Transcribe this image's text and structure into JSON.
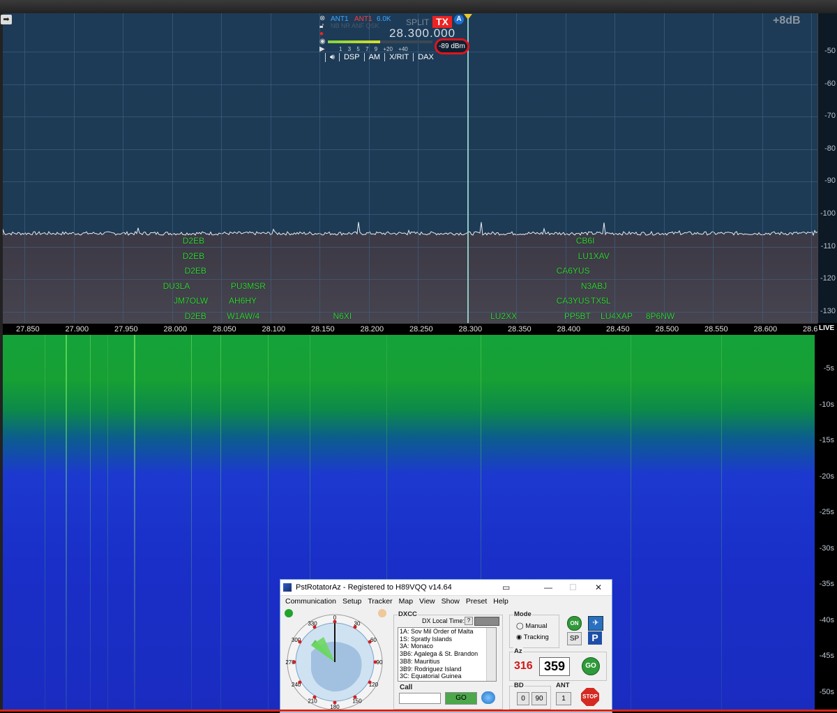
{
  "panadapter": {
    "db_scale": [
      "-50",
      "-60",
      "-70",
      "-80",
      "-90",
      "-100",
      "-110",
      "-120",
      "-130"
    ],
    "gain_label": "+8dB",
    "freq_axis": [
      "27.850",
      "27.900",
      "27.950",
      "28.000",
      "28.050",
      "28.100",
      "28.150",
      "28.200",
      "28.250",
      "28.300",
      "28.350",
      "28.400",
      "28.450",
      "28.500",
      "28.550",
      "28.600",
      "28.6"
    ],
    "live_label": "LIVE",
    "spots": [
      {
        "call": "D2EB",
        "f": 28.025,
        "row": 0
      },
      {
        "call": "D2EB",
        "f": 28.025,
        "row": 1
      },
      {
        "call": "D2EB",
        "f": 28.027,
        "row": 2
      },
      {
        "call": "DU3LA",
        "f": 28.005,
        "row": 3
      },
      {
        "call": "PU3MSR",
        "f": 28.074,
        "row": 3
      },
      {
        "call": "JM7OLW",
        "f": 28.016,
        "row": 4
      },
      {
        "call": "AH6HY",
        "f": 28.072,
        "row": 4
      },
      {
        "call": "D2EB",
        "f": 28.027,
        "row": 5
      },
      {
        "call": "W1AW/4",
        "f": 28.07,
        "row": 5
      },
      {
        "call": "N6XI",
        "f": 28.178,
        "row": 5
      },
      {
        "call": "LU2XX",
        "f": 28.338,
        "row": 5
      },
      {
        "call": "CB6I",
        "f": 28.425,
        "row": 0
      },
      {
        "call": "LU1XAV",
        "f": 28.427,
        "row": 1
      },
      {
        "call": "CA6YUS",
        "f": 28.405,
        "row": 2
      },
      {
        "call": "N3ABJ",
        "f": 28.43,
        "row": 3
      },
      {
        "call": "CA3YUS",
        "f": 28.405,
        "row": 4
      },
      {
        "call": "TX5L",
        "f": 28.44,
        "row": 4
      },
      {
        "call": "PP5BT",
        "f": 28.413,
        "row": 5
      },
      {
        "call": "LU4XAP",
        "f": 28.45,
        "row": 5
      },
      {
        "call": "8P6NW",
        "f": 28.496,
        "row": 5
      }
    ]
  },
  "slice_flag": {
    "antenna_rx": "ANT1",
    "antenna_tx": "ANT1",
    "bandwidth": "6.0K",
    "modes_text": "NB NR ANF QSK",
    "split_label": "SPLIT",
    "tx_label": "TX",
    "slice_letter": "A",
    "frequency": "28.300.000",
    "meter_ticks": "1 3 5 7 9 +20 +40",
    "signal_level": "-89 dBm",
    "buttons": [
      "DSP",
      "AM",
      "X/RIT",
      "DAX"
    ]
  },
  "waterfall": {
    "time_scale": [
      "5s",
      "10s",
      "15s",
      "20s",
      "25s",
      "30s",
      "35s",
      "40s",
      "45s",
      "50s"
    ]
  },
  "rotator": {
    "title": "PstRotatorAz - Registered to H89VQQ   v14.64",
    "menu": [
      "Communication",
      "Setup",
      "Tracker",
      "Map",
      "View",
      "Show",
      "Preset",
      "Help"
    ],
    "compass_labels": [
      "0",
      "30",
      "60",
      "90",
      "120",
      "150",
      "180",
      "210",
      "240",
      "270",
      "300",
      "330"
    ],
    "dxcc_label": "DXCC",
    "dx_local_time_label": "DX Local Time:",
    "dx_local_time_value": "?",
    "dxcc_list": [
      "1A:   Sov Mil Order of Malta",
      "1S:   Spratly Islands",
      "3A:   Monaco",
      "3B6:  Agalega & St. Brandon",
      "3B8:  Mauritius",
      "3B9:  Rodriguez Island",
      "3C:   Equatorial Guinea"
    ],
    "call_label": "Call",
    "call_value": "",
    "go_label": "GO",
    "mode_label": "Mode",
    "mode_manual": "Manual",
    "mode_tracking": "Tracking",
    "mode_selected": "Tracking",
    "on_label": "ON",
    "sp_label": "SP",
    "p_label": "P",
    "az_label": "Az",
    "az_current": "316",
    "az_target": "359",
    "az_go": "GO",
    "bd_label": "BD",
    "bd_buttons": [
      "0",
      "90"
    ],
    "ant_label": "ANT",
    "ant_value": "1",
    "stop_label": "STOP"
  }
}
